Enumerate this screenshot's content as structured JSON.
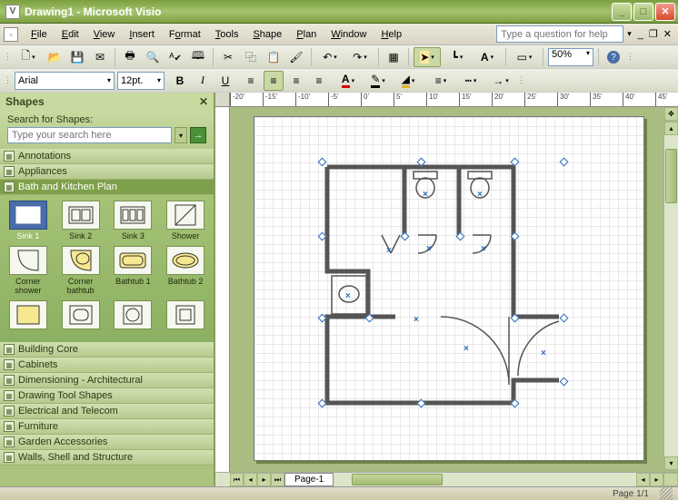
{
  "window": {
    "title": "Drawing1 - Microsoft Visio"
  },
  "menu": {
    "file": "File",
    "edit": "Edit",
    "view": "View",
    "insert": "Insert",
    "format": "Format",
    "tools": "Tools",
    "shape": "Shape",
    "plan": "Plan",
    "window": "Window",
    "help": "Help"
  },
  "help_search_placeholder": "Type a question for help",
  "zoom": "50%",
  "font": {
    "name": "Arial",
    "size": "12pt."
  },
  "shapes_panel": {
    "title": "Shapes",
    "search_label": "Search for Shapes:",
    "search_placeholder": "Type your search here",
    "stencils": {
      "annotations": "Annotations",
      "appliances": "Appliances",
      "bath": "Bath and Kitchen Plan",
      "building": "Building Core",
      "cabinets": "Cabinets",
      "dimensioning": "Dimensioning - Architectural",
      "drawing": "Drawing Tool Shapes",
      "electrical": "Electrical and Telecom",
      "furniture": "Furniture",
      "garden": "Garden Accessories",
      "walls": "Walls, Shell and Structure"
    },
    "masters": {
      "sink1": "Sink 1",
      "sink2": "Sink 2",
      "sink3": "Sink 3",
      "shower": "Shower",
      "corner_shower": "Corner shower",
      "corner_bathtub": "Corner bathtub",
      "bathtub1": "Bathtub 1",
      "bathtub2": "Bathtub 2"
    }
  },
  "page_tab": "Page-1",
  "status": {
    "page": "Page 1/1"
  },
  "ruler_ticks": [
    "-20'",
    "-15'",
    "-10'",
    "-5'",
    "0'",
    "5'",
    "10'",
    "15'",
    "20'",
    "25'",
    "30'",
    "35'",
    "40'",
    "45'"
  ]
}
